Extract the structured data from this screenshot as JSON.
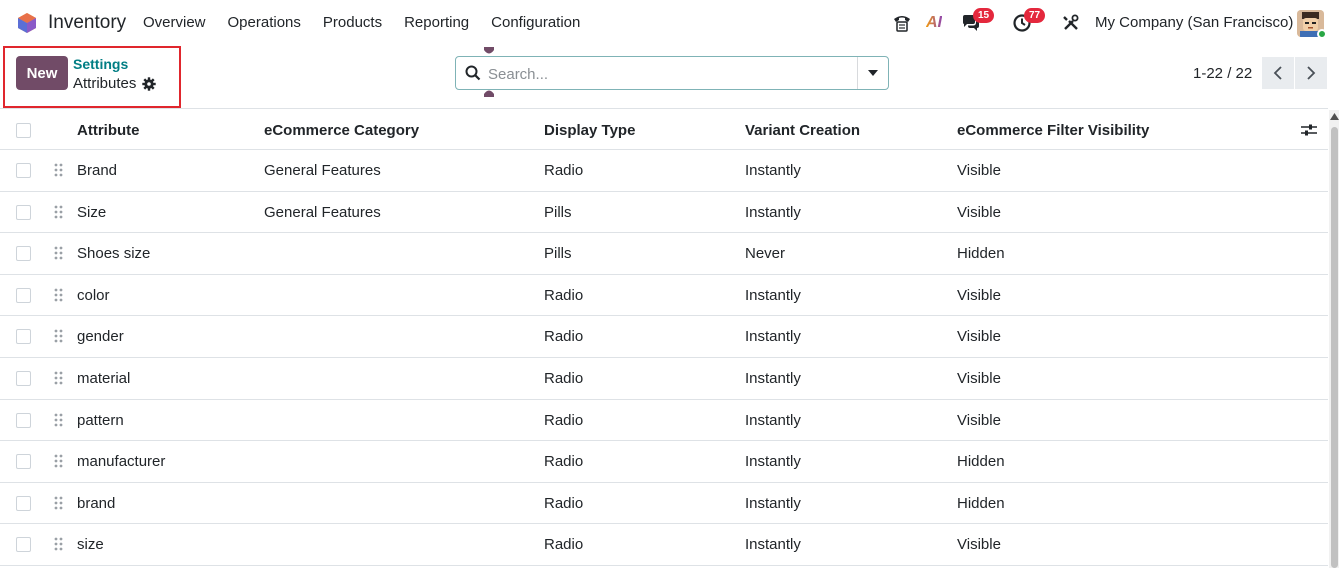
{
  "navbar": {
    "app_name": "Inventory",
    "menu": [
      "Overview",
      "Operations",
      "Products",
      "Reporting",
      "Configuration"
    ],
    "chat_badge": "15",
    "activity_badge": "77",
    "ai_label": "AI",
    "company": "My Company (San Francisco)"
  },
  "control_panel": {
    "new_label": "New",
    "breadcrumb_parent": "Settings",
    "breadcrumb_current": "Attributes",
    "search_placeholder": "Search...",
    "pager": "1-22 / 22"
  },
  "table": {
    "headers": [
      "Attribute",
      "eCommerce Category",
      "Display Type",
      "Variant Creation",
      "eCommerce Filter Visibility"
    ],
    "rows": [
      [
        "Brand",
        "General Features",
        "Radio",
        "Instantly",
        "Visible"
      ],
      [
        "Size",
        "General Features",
        "Pills",
        "Instantly",
        "Visible"
      ],
      [
        "Shoes size",
        "",
        "Pills",
        "Never",
        "Hidden"
      ],
      [
        "color",
        "",
        "Radio",
        "Instantly",
        "Visible"
      ],
      [
        "gender",
        "",
        "Radio",
        "Instantly",
        "Visible"
      ],
      [
        "material",
        "",
        "Radio",
        "Instantly",
        "Visible"
      ],
      [
        "pattern",
        "",
        "Radio",
        "Instantly",
        "Visible"
      ],
      [
        "manufacturer",
        "",
        "Radio",
        "Instantly",
        "Hidden"
      ],
      [
        "brand",
        "",
        "Radio",
        "Instantly",
        "Hidden"
      ],
      [
        "size",
        "",
        "Radio",
        "Instantly",
        "Visible"
      ]
    ]
  },
  "colors": {
    "primary": "#714b67",
    "link": "#017e84",
    "badge": "#e4283d",
    "highlight": "#e0262d"
  }
}
